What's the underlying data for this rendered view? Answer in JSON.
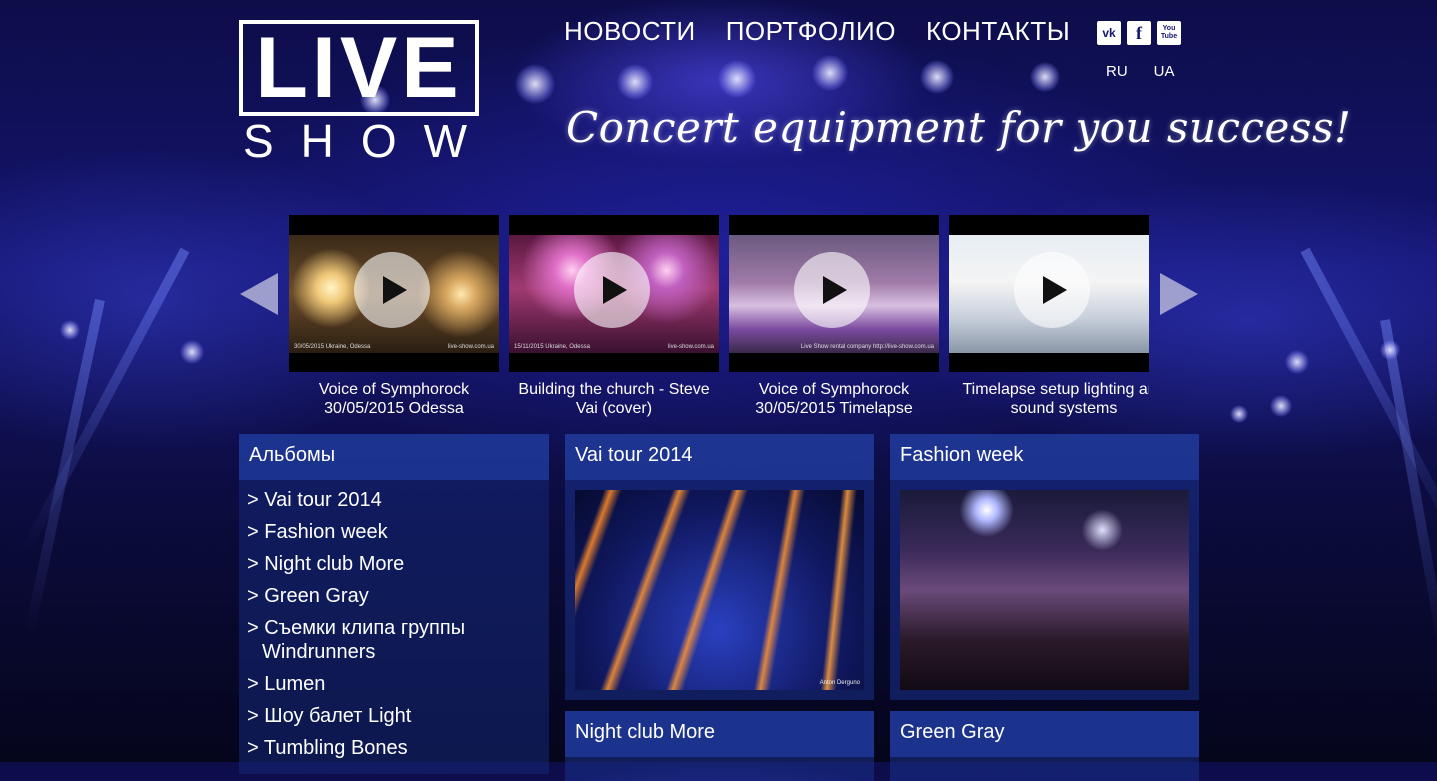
{
  "logo": {
    "main": "LIVE",
    "sub": "SHOW"
  },
  "nav": [
    "НОВОСТИ",
    "ПОРТФОЛИО",
    "КОНТАКТЫ"
  ],
  "social": [
    {
      "icon": "vk-icon",
      "label": "vk"
    },
    {
      "icon": "facebook-icon",
      "label": "f"
    },
    {
      "icon": "youtube-icon",
      "label": "You Tube"
    }
  ],
  "langs": [
    "RU",
    "UA"
  ],
  "tagline": "Concert equipment for you success!",
  "videos": [
    {
      "title": "Voice of Symphorock 30/05/2015 Odessa",
      "caption_left": "30/05/2015 Ukraine, Odessa",
      "caption_right": "live-show.com.ua"
    },
    {
      "title": "Building the church - Steve Vai (cover)",
      "caption_left": "15/11/2015 Ukraine, Odessa",
      "caption_right": "live-show.com.ua"
    },
    {
      "title": "Voice of Symphorock 30/05/2015 Timelapse",
      "caption_left": "",
      "caption_right": "Live Show rental company http://live-show.com.ua"
    },
    {
      "title": "Timelapse setup lighting and sound systems",
      "caption_left": "",
      "caption_right": ""
    }
  ],
  "albums": {
    "heading": "Альбомы",
    "items": [
      "> Vai tour 2014",
      "> Fashion week",
      "> Night club More",
      "> Green Gray",
      "> Съемки клипа группы Windrunners",
      "> Lumen",
      "> Шоу балет Light",
      "> Tumbling Bones"
    ]
  },
  "cards": [
    {
      "title": "Vai tour 2014",
      "photo_credit": "Anton Derguno"
    },
    {
      "title": "Fashion week"
    },
    {
      "title": "Night club More"
    },
    {
      "title": "Green Gray"
    }
  ]
}
